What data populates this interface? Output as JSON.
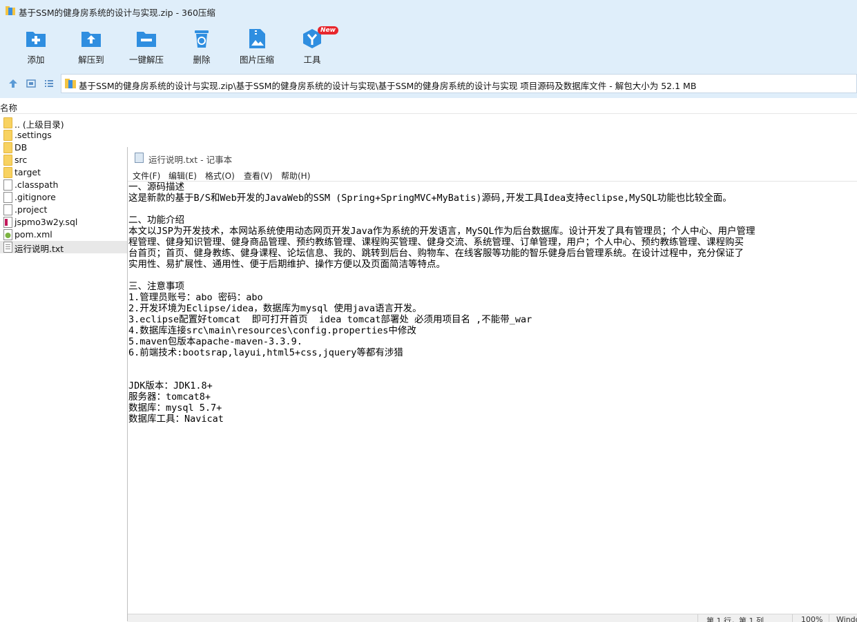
{
  "window": {
    "title": "基于SSM的健身房系统的设计与实现.zip - 360压缩"
  },
  "toolbar": {
    "buttons": [
      {
        "label": "添加",
        "icon": "add-icon"
      },
      {
        "label": "解压到",
        "icon": "extract-to-icon"
      },
      {
        "label": "一键解压",
        "icon": "one-click-extract-icon"
      },
      {
        "label": "删除",
        "icon": "delete-icon"
      },
      {
        "label": "图片压缩",
        "icon": "image-compress-icon"
      },
      {
        "label": "工具",
        "icon": "tools-icon",
        "badge": "New"
      }
    ]
  },
  "address": {
    "path": "基于SSM的健身房系统的设计与实现.zip\\基于SSM的健身房系统的设计与实现\\基于SSM的健身房系统的设计与实现 项目源码及数据库文件 - 解包大小为 52.1 MB"
  },
  "filelist": {
    "column_name": "名称",
    "items": [
      {
        "name": ".. (上级目录)",
        "type": "folder"
      },
      {
        "name": ".settings",
        "type": "folder"
      },
      {
        "name": "DB",
        "type": "folder"
      },
      {
        "name": "src",
        "type": "folder"
      },
      {
        "name": "target",
        "type": "folder"
      },
      {
        "name": ".classpath",
        "type": "file"
      },
      {
        "name": ".gitignore",
        "type": "file"
      },
      {
        "name": ".project",
        "type": "file"
      },
      {
        "name": "jspmo3w2y.sql",
        "type": "sql"
      },
      {
        "name": "pom.xml",
        "type": "xml"
      },
      {
        "name": "运行说明.txt",
        "type": "txt",
        "selected": true
      }
    ]
  },
  "notepad": {
    "title": "运行说明.txt - 记事本",
    "menu": [
      "文件(F)",
      "编辑(E)",
      "格式(O)",
      "查看(V)",
      "帮助(H)"
    ],
    "lines": [
      "一、源码描述",
      "这是新款的基于B/S和Web开发的JavaWeb的SSM (Spring+SpringMVC+MyBatis)源码,开发工具Idea支持eclipse,MySQL功能也比较全面。",
      "",
      "二、功能介绍",
      "本文以JSP为开发技术，本网站系统使用动态网页开发Java作为系统的开发语言，MySQL作为后台数据库。设计开发了具有管理员；个人中心、用户管理",
      "程管理、健身知识管理、健身商品管理、预约教练管理、课程购买管理、健身交流、系统管理、订单管理，用户；个人中心、预约教练管理、课程购买",
      "台首页；首页、健身教练、健身课程、论坛信息、我的、跳转到后台、购物车、在线客服等功能的智乐健身后台管理系统。在设计过程中，充分保证了",
      "实用性、易扩展性、通用性、便于后期维护、操作方便以及页面简洁等特点。",
      "",
      "三、注意事项",
      "1.管理员账号：abo 密码：abo",
      "2.开发环境为Eclipse/idea，数据库为mysql 使用java语言开发。",
      "3.eclipse配置好tomcat  即可打开首页  idea tomcat部署处 必须用项目名 ,不能带_war",
      "4.数据库连接src\\main\\resources\\config.properties中修改",
      "5.maven包版本apache-maven-3.3.9.",
      "6.前端技术:bootsrap,layui,html5+css,jquery等都有涉猎",
      "",
      "",
      "JDK版本：JDK1.8+",
      "服务器：tomcat8+",
      "数据库：mysql 5.7+",
      "数据库工具：Navicat"
    ],
    "status": {
      "position": "第 1 行，第 1 列",
      "zoom": "100%",
      "encoding": "Windows (CRLF)"
    }
  },
  "colors": {
    "chrome_bg": "#dfeefa",
    "icon_blue": "#2f8ee0",
    "badge_red": "#e8262c",
    "selected_row": "#e8e8e8"
  }
}
